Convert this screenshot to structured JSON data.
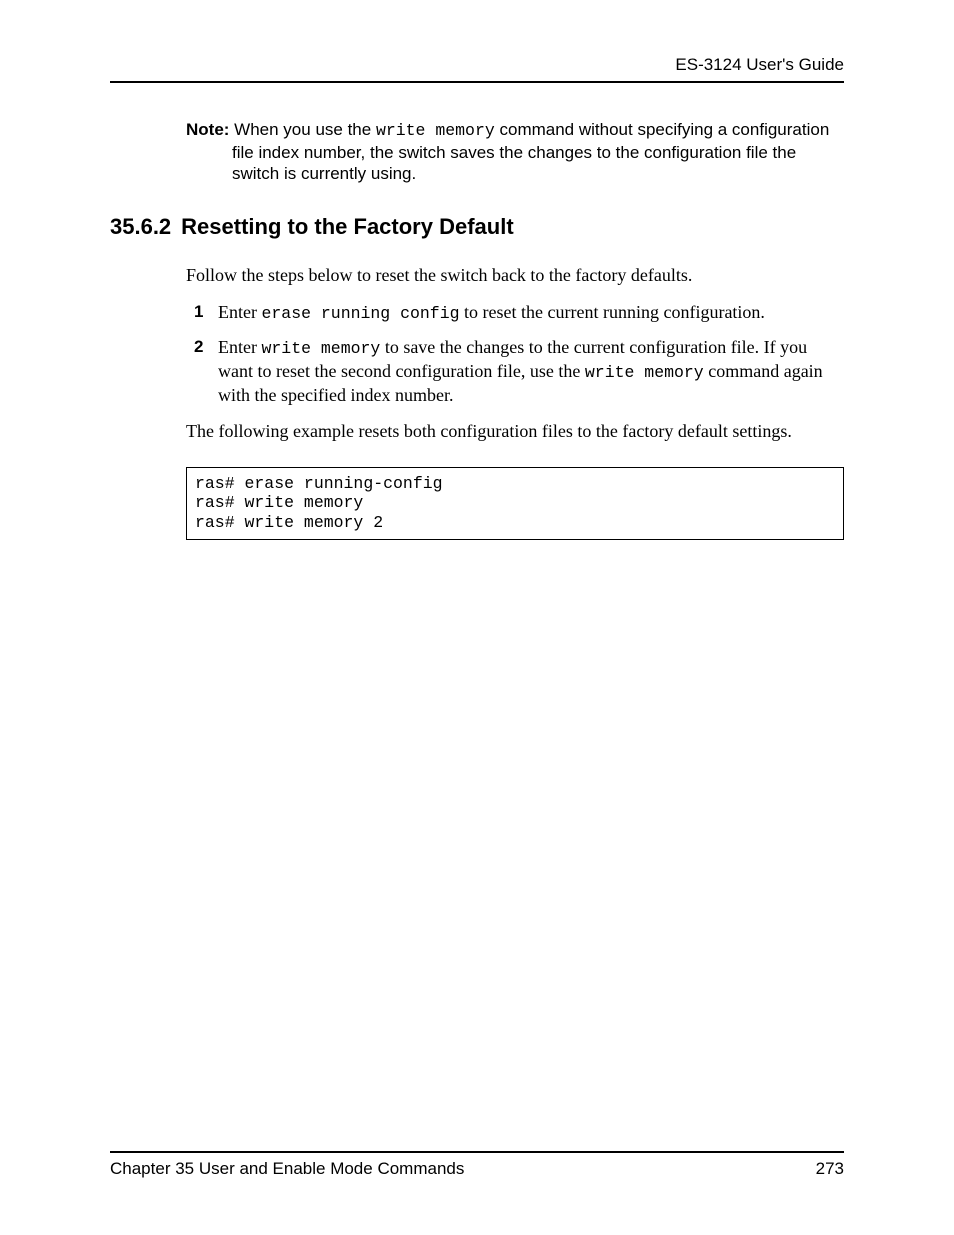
{
  "header": {
    "guide_title": "ES-3124 User's Guide"
  },
  "note": {
    "label": "Note:",
    "text_before_code": " When you use the ",
    "code": "write memory",
    "text_after_code": " command without specifying a configuration",
    "line2": "file index number, the switch saves the changes to the configuration file the",
    "line3": "switch is currently using."
  },
  "section": {
    "number": "35.6.2",
    "title": "Resetting to the Factory Default"
  },
  "intro_para": "Follow the steps below to reset the switch back to the factory defaults.",
  "steps": [
    {
      "num": "1",
      "before_code": "Enter ",
      "code": "erase running config",
      "after_code": " to reset the current running configuration."
    },
    {
      "num": "2",
      "before_code": "Enter ",
      "code": "write memory",
      "after_code": " to save the changes to the current configuration file. If you want to reset the second configuration file, use the ",
      "code2": "write memory",
      "after_code2": " command again with the specified index number."
    }
  ],
  "example_para": "The following example resets both configuration files to the factory default settings.",
  "code_block": "ras# erase running-config\nras# write memory\nras# write memory 2",
  "footer": {
    "chapter": "Chapter 35 User and Enable Mode Commands",
    "page": "273"
  }
}
